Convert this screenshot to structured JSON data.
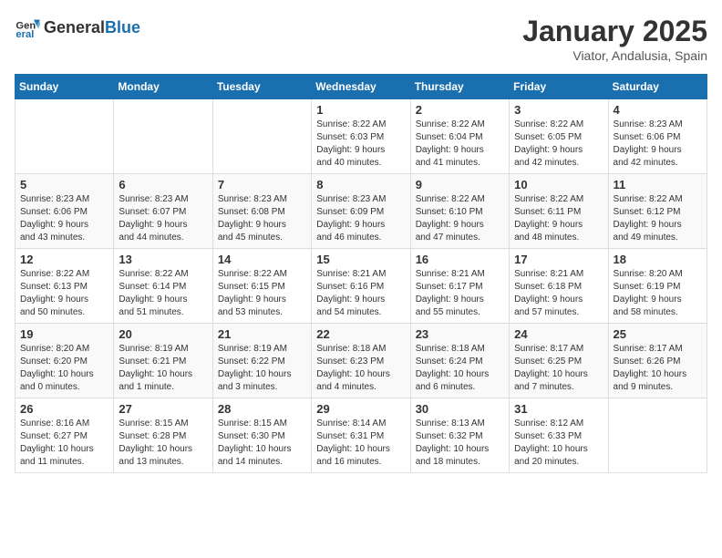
{
  "header": {
    "logo_general": "General",
    "logo_blue": "Blue",
    "title": "January 2025",
    "location": "Viator, Andalusia, Spain"
  },
  "weekdays": [
    "Sunday",
    "Monday",
    "Tuesday",
    "Wednesday",
    "Thursday",
    "Friday",
    "Saturday"
  ],
  "weeks": [
    [
      {
        "day": "",
        "info": ""
      },
      {
        "day": "",
        "info": ""
      },
      {
        "day": "",
        "info": ""
      },
      {
        "day": "1",
        "info": "Sunrise: 8:22 AM\nSunset: 6:03 PM\nDaylight: 9 hours\nand 40 minutes."
      },
      {
        "day": "2",
        "info": "Sunrise: 8:22 AM\nSunset: 6:04 PM\nDaylight: 9 hours\nand 41 minutes."
      },
      {
        "day": "3",
        "info": "Sunrise: 8:22 AM\nSunset: 6:05 PM\nDaylight: 9 hours\nand 42 minutes."
      },
      {
        "day": "4",
        "info": "Sunrise: 8:23 AM\nSunset: 6:06 PM\nDaylight: 9 hours\nand 42 minutes."
      }
    ],
    [
      {
        "day": "5",
        "info": "Sunrise: 8:23 AM\nSunset: 6:06 PM\nDaylight: 9 hours\nand 43 minutes."
      },
      {
        "day": "6",
        "info": "Sunrise: 8:23 AM\nSunset: 6:07 PM\nDaylight: 9 hours\nand 44 minutes."
      },
      {
        "day": "7",
        "info": "Sunrise: 8:23 AM\nSunset: 6:08 PM\nDaylight: 9 hours\nand 45 minutes."
      },
      {
        "day": "8",
        "info": "Sunrise: 8:23 AM\nSunset: 6:09 PM\nDaylight: 9 hours\nand 46 minutes."
      },
      {
        "day": "9",
        "info": "Sunrise: 8:22 AM\nSunset: 6:10 PM\nDaylight: 9 hours\nand 47 minutes."
      },
      {
        "day": "10",
        "info": "Sunrise: 8:22 AM\nSunset: 6:11 PM\nDaylight: 9 hours\nand 48 minutes."
      },
      {
        "day": "11",
        "info": "Sunrise: 8:22 AM\nSunset: 6:12 PM\nDaylight: 9 hours\nand 49 minutes."
      }
    ],
    [
      {
        "day": "12",
        "info": "Sunrise: 8:22 AM\nSunset: 6:13 PM\nDaylight: 9 hours\nand 50 minutes."
      },
      {
        "day": "13",
        "info": "Sunrise: 8:22 AM\nSunset: 6:14 PM\nDaylight: 9 hours\nand 51 minutes."
      },
      {
        "day": "14",
        "info": "Sunrise: 8:22 AM\nSunset: 6:15 PM\nDaylight: 9 hours\nand 53 minutes."
      },
      {
        "day": "15",
        "info": "Sunrise: 8:21 AM\nSunset: 6:16 PM\nDaylight: 9 hours\nand 54 minutes."
      },
      {
        "day": "16",
        "info": "Sunrise: 8:21 AM\nSunset: 6:17 PM\nDaylight: 9 hours\nand 55 minutes."
      },
      {
        "day": "17",
        "info": "Sunrise: 8:21 AM\nSunset: 6:18 PM\nDaylight: 9 hours\nand 57 minutes."
      },
      {
        "day": "18",
        "info": "Sunrise: 8:20 AM\nSunset: 6:19 PM\nDaylight: 9 hours\nand 58 minutes."
      }
    ],
    [
      {
        "day": "19",
        "info": "Sunrise: 8:20 AM\nSunset: 6:20 PM\nDaylight: 10 hours\nand 0 minutes."
      },
      {
        "day": "20",
        "info": "Sunrise: 8:19 AM\nSunset: 6:21 PM\nDaylight: 10 hours\nand 1 minute."
      },
      {
        "day": "21",
        "info": "Sunrise: 8:19 AM\nSunset: 6:22 PM\nDaylight: 10 hours\nand 3 minutes."
      },
      {
        "day": "22",
        "info": "Sunrise: 8:18 AM\nSunset: 6:23 PM\nDaylight: 10 hours\nand 4 minutes."
      },
      {
        "day": "23",
        "info": "Sunrise: 8:18 AM\nSunset: 6:24 PM\nDaylight: 10 hours\nand 6 minutes."
      },
      {
        "day": "24",
        "info": "Sunrise: 8:17 AM\nSunset: 6:25 PM\nDaylight: 10 hours\nand 7 minutes."
      },
      {
        "day": "25",
        "info": "Sunrise: 8:17 AM\nSunset: 6:26 PM\nDaylight: 10 hours\nand 9 minutes."
      }
    ],
    [
      {
        "day": "26",
        "info": "Sunrise: 8:16 AM\nSunset: 6:27 PM\nDaylight: 10 hours\nand 11 minutes."
      },
      {
        "day": "27",
        "info": "Sunrise: 8:15 AM\nSunset: 6:28 PM\nDaylight: 10 hours\nand 13 minutes."
      },
      {
        "day": "28",
        "info": "Sunrise: 8:15 AM\nSunset: 6:30 PM\nDaylight: 10 hours\nand 14 minutes."
      },
      {
        "day": "29",
        "info": "Sunrise: 8:14 AM\nSunset: 6:31 PM\nDaylight: 10 hours\nand 16 minutes."
      },
      {
        "day": "30",
        "info": "Sunrise: 8:13 AM\nSunset: 6:32 PM\nDaylight: 10 hours\nand 18 minutes."
      },
      {
        "day": "31",
        "info": "Sunrise: 8:12 AM\nSunset: 6:33 PM\nDaylight: 10 hours\nand 20 minutes."
      },
      {
        "day": "",
        "info": ""
      }
    ]
  ]
}
